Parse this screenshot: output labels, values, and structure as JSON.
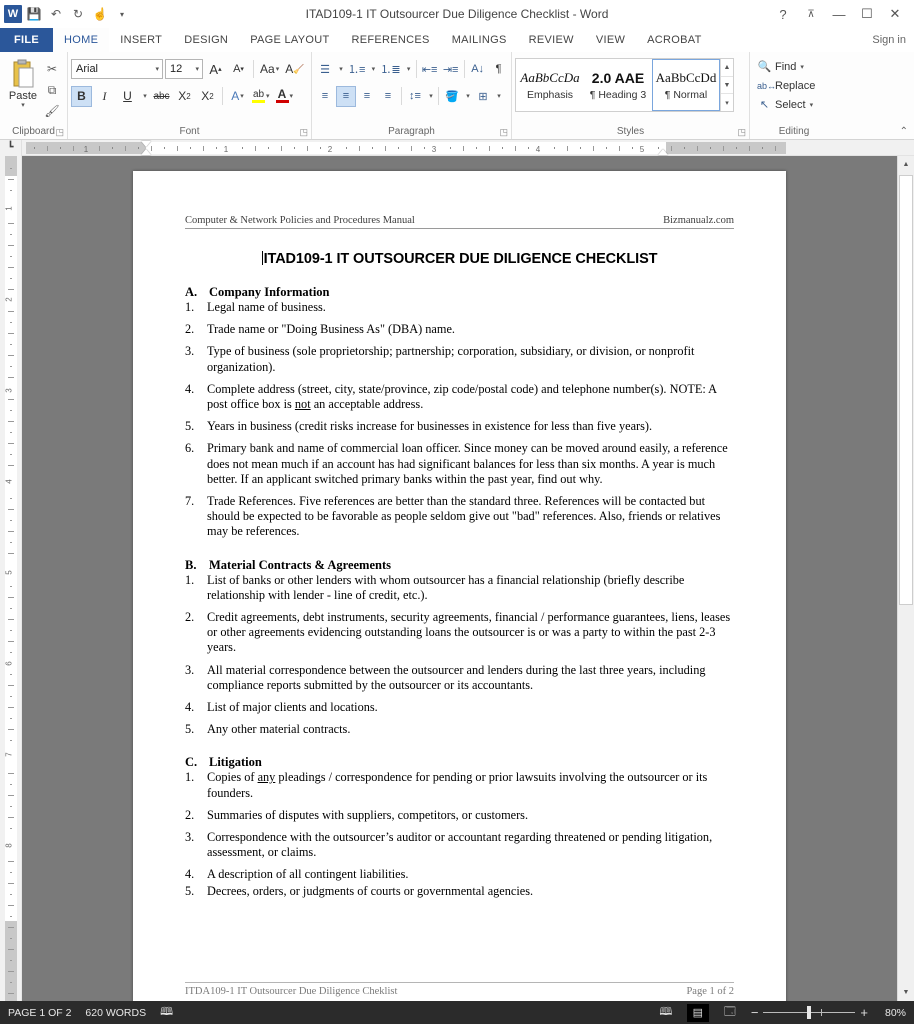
{
  "window": {
    "title": "ITAD109-1 IT Outsourcer Due Diligence Checklist - Word",
    "help_icon": "?",
    "ribbon_display_icon": "⬆",
    "minimize_icon": "—",
    "maximize_icon": "☐",
    "close_icon": "✕",
    "signin": "Sign in"
  },
  "qat": {
    "logo": "W",
    "save_icon": "💾",
    "undo_icon": "↶",
    "redo_icon": "↻",
    "touch_icon": "☝",
    "more_icon": "☰"
  },
  "tabs": [
    {
      "label": "FILE",
      "active": false
    },
    {
      "label": "HOME",
      "active": true
    },
    {
      "label": "INSERT",
      "active": false
    },
    {
      "label": "DESIGN",
      "active": false
    },
    {
      "label": "PAGE LAYOUT",
      "active": false
    },
    {
      "label": "REFERENCES",
      "active": false
    },
    {
      "label": "MAILINGS",
      "active": false
    },
    {
      "label": "REVIEW",
      "active": false
    },
    {
      "label": "VIEW",
      "active": false
    },
    {
      "label": "ACROBAT",
      "active": false
    }
  ],
  "ribbon": {
    "clipboard": {
      "group_label": "Clipboard",
      "paste_label": "Paste",
      "cut_icon": "✂",
      "copy_icon": "⧉",
      "format_painter_icon": "🖌"
    },
    "font": {
      "group_label": "Font",
      "font_name": "Arial",
      "font_size": "12",
      "grow_font": "A",
      "shrink_font": "A",
      "change_case": "Aa",
      "clear_formatting": "A",
      "bold": "B",
      "italic": "I",
      "underline": "U",
      "strikethrough": "abc",
      "subscript": "X",
      "superscript": "X",
      "text_effects": "A",
      "highlight": "ab",
      "font_color": "A"
    },
    "paragraph": {
      "group_label": "Paragraph",
      "bullets": "☰",
      "numbering": "≡",
      "multilevel": "≣",
      "decrease_indent": "←",
      "increase_indent": "→",
      "sort": "A↓",
      "show_marks": "¶",
      "align_left": "≡",
      "align_center": "≡",
      "align_right": "≡",
      "justify": "≡",
      "line_spacing": "↕",
      "shading": "■",
      "borders": "⊞"
    },
    "styles": {
      "group_label": "Styles",
      "items": [
        {
          "preview": "AaBbCcDa",
          "name": "Emphasis",
          "selected": false
        },
        {
          "preview": "2.0  AAE",
          "name": "¶ Heading 3",
          "selected": false
        },
        {
          "preview": "AaBbCcDd",
          "name": "¶ Normal",
          "selected": true
        }
      ]
    },
    "editing": {
      "group_label": "Editing",
      "find": "Find",
      "replace": "Replace",
      "select": "Select",
      "find_icon": "🔍",
      "replace_icon": "ab",
      "select_icon": "➤"
    },
    "collapse_icon": "⌃"
  },
  "ruler": {
    "tab_selector_icon": "┗",
    "h_ticks": [
      "1",
      "1",
      "2",
      "3",
      "4",
      "5"
    ],
    "v_ticks": [
      "1",
      "2",
      "3",
      "4",
      "5",
      "6",
      "7",
      "8"
    ]
  },
  "document": {
    "header_left": "Computer & Network Policies and Procedures Manual",
    "header_right": "Bizmanualz.com",
    "title": "ITAD109-1   IT OUTSOURCER DUE DILIGENCE CHECKLIST",
    "sections": [
      {
        "letter": "A.",
        "heading": "Company Information",
        "items": [
          {
            "num": "1.",
            "text": "Legal name of business."
          },
          {
            "num": "2.",
            "text": "Trade name or \"Doing Business As\" (DBA) name."
          },
          {
            "num": "3.",
            "text": "Type of business (sole proprietorship; partnership; corporation, subsidiary, or division, or nonprofit organization)."
          },
          {
            "num": "4.",
            "text": "Complete address (street, city, state/province, zip code/postal code) and telephone number(s).  NOTE: A post office box is ",
            "underline": "not",
            "text_after": " an acceptable address."
          },
          {
            "num": "5.",
            "text": "Years in business (credit risks increase for businesses in existence for less than five years)."
          },
          {
            "num": "6.",
            "text": "Primary bank and name of commercial loan officer. Since money can be moved around easily, a reference does not mean much if an account has had significant balances for less than six months.  A year is much better. If an applicant switched primary banks within the past year, find out why."
          },
          {
            "num": "7.",
            "text": "Trade References.  Five references are better than the standard three.  References will be contacted but should be expected to be favorable as people seldom give out \"bad\" references.  Also, friends or relatives may be references."
          }
        ]
      },
      {
        "letter": "B.",
        "heading": "Material Contracts & Agreements",
        "items": [
          {
            "num": "1.",
            "text": "List of banks or other lenders with whom outsourcer has a financial relationship (briefly describe relationship with lender - line of credit, etc.)."
          },
          {
            "num": "2.",
            "text": "Credit agreements, debt instruments, security agreements, financial / performance guarantees, liens, leases or other agreements evidencing outstanding loans the outsourcer is or was a party to within the past 2-3 years."
          },
          {
            "num": "3.",
            "text": "All material correspondence between the outsourcer and lenders during the last three years, including compliance reports submitted by the outsourcer or its accountants."
          },
          {
            "num": "4.",
            "text": "List of major clients and locations."
          },
          {
            "num": "5.",
            "text": "Any other material contracts."
          }
        ]
      },
      {
        "letter": "C.",
        "heading": "Litigation",
        "items": [
          {
            "num": "1.",
            "text": "Copies of ",
            "underline": "any",
            "text_after": " pleadings / correspondence for pending or prior lawsuits involving the outsourcer or its founders."
          },
          {
            "num": "2.",
            "text": "Summaries of disputes with suppliers, competitors, or customers."
          },
          {
            "num": "3.",
            "text": "Correspondence with the outsourcer’s auditor or accountant regarding threatened or pending litigation, assessment, or claims."
          },
          {
            "num": "4.",
            "text": "A description of all contingent liabilities."
          },
          {
            "num": "5.",
            "text": "Decrees, orders, or judgments of courts or governmental agencies."
          }
        ]
      }
    ],
    "footer_left": "ITDA109-1 IT Outsourcer Due Diligence Cheklist",
    "footer_right": "Page 1 of 2"
  },
  "status": {
    "page": "PAGE 1 OF 2",
    "words": "620 WORDS",
    "proofing_icon": "📖",
    "read_mode_icon": "📖",
    "print_layout_icon": "☰",
    "web_layout_icon": "🗔",
    "zoom_out": "−",
    "zoom_in": "+",
    "zoom_level": "80%"
  }
}
